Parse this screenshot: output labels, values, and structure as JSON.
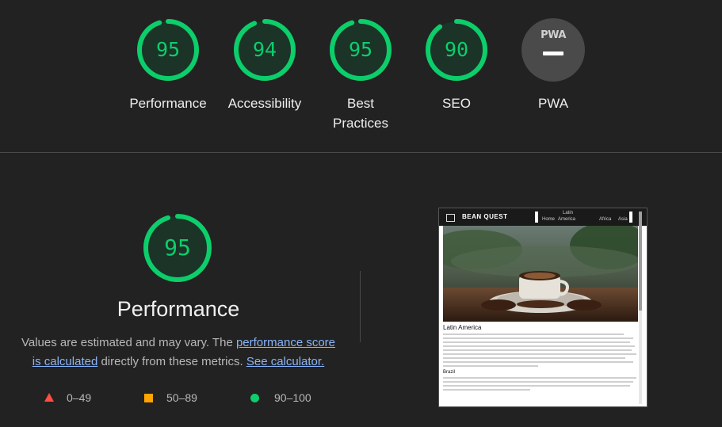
{
  "top_scores": [
    {
      "label": "Performance",
      "score": "95",
      "fraction": 0.95
    },
    {
      "label": "Accessibility",
      "score": "94",
      "fraction": 0.94
    },
    {
      "label": "Best Practices",
      "score": "95",
      "fraction": 0.95
    },
    {
      "label": "SEO",
      "score": "90",
      "fraction": 0.9
    }
  ],
  "pwa": {
    "badge_text": "PWA",
    "label": "PWA"
  },
  "performance": {
    "score": "95",
    "fraction": 0.95,
    "title": "Performance",
    "desc_prefix": "Values are estimated and may vary. The ",
    "link_score": "performance score is calculated",
    "desc_middle": " directly from these metrics. ",
    "link_calculator": "See calculator."
  },
  "legend": [
    {
      "label": "0–49",
      "color": "#ff4e42"
    },
    {
      "label": "50–89",
      "color": "#ffa400"
    },
    {
      "label": "90–100",
      "color": "#0cce6b"
    }
  ],
  "screenshot": {
    "brand": "BEAN QUEST",
    "nav_top": "Latin",
    "nav_home": "Home",
    "nav_america": "America",
    "nav_africa": "Africa",
    "nav_asia": "Asia",
    "heading": "Latin America",
    "subheading": "Brazil"
  },
  "colors": {
    "pass": "#0cce6b",
    "track": "#0c4d2b",
    "background": "#222222"
  }
}
